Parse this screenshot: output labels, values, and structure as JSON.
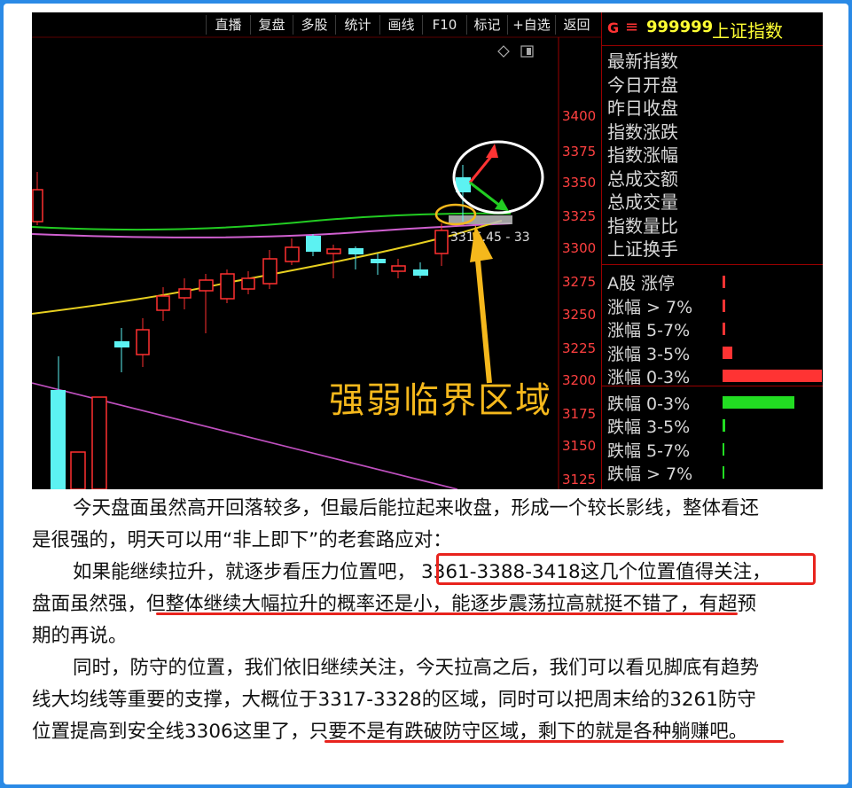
{
  "toolbar": {
    "buttons": [
      "直播",
      "复盘",
      "多股",
      "统计",
      "画线",
      "F10",
      "标记",
      "+自选",
      "返回"
    ]
  },
  "chart": {
    "price_label": "3316.45 - 33",
    "annotation": "强弱临界区域",
    "y_ticks": [
      "3400",
      "3375",
      "3350",
      "3325",
      "3300",
      "3275",
      "3250",
      "3225",
      "3200",
      "3175",
      "3150",
      "3125"
    ]
  },
  "right_panel": {
    "g_label": "G",
    "menu_icon": "≡",
    "code": "999999",
    "name": "上证指数",
    "indicators": [
      "最新指数",
      "今日开盘",
      "昨日收盘",
      "指数涨跌",
      "指数涨幅",
      "总成交额",
      "总成交量",
      "指数量比",
      "上证换手"
    ],
    "breakdown": [
      {
        "label": "A股 涨停",
        "bar_color": "#ff3333",
        "bar_fraction": 0.03
      },
      {
        "label": "涨幅 > 7%",
        "bar_color": "#ff3333",
        "bar_fraction": 0.03
      },
      {
        "label": "涨幅 5-7%",
        "bar_color": "#ff3333",
        "bar_fraction": 0.03
      },
      {
        "label": "涨幅 3-5%",
        "bar_color": "#ff3333",
        "bar_fraction": 0.1
      },
      {
        "label": "涨幅 0-3%",
        "bar_color": "#ff3333",
        "bar_fraction": 1.0
      },
      {
        "label": "跌幅 0-3%",
        "bar_color": "#22dd22",
        "bar_fraction": 0.72
      },
      {
        "label": "跌幅 3-5%",
        "bar_color": "#22dd22",
        "bar_fraction": 0.03
      },
      {
        "label": "跌幅 5-7%",
        "bar_color": "#22dd22",
        "bar_fraction": 0.01
      },
      {
        "label": "跌幅 > 7%",
        "bar_color": "#22dd22",
        "bar_fraction": 0.01
      }
    ]
  },
  "article": {
    "p1_a": "今天盘面虽然高开回落较多，但最后能拉起来收盘，形成一个较长影线，整体看还",
    "p1_b": "是很强的，明天可以用“非上即下”的老套路应对：",
    "p2_a": "如果能继续拉升，就逐步看压力位置吧，",
    "p2_box": "3361-3388-3418这几个位置值得关注，",
    "p2_b_pre": "盘面虽然强，",
    "p2_b_ul": "但整体继续大幅拉升的概率还是小，能逐步震荡拉高就挺不错了",
    "p2_b_post": "，有超预",
    "p2_c": "期的再说。",
    "p3_a": "同时，防守的位置，我们依旧继续关注，今天拉高之后，我们可以看见脚底有趋势",
    "p3_b": "线大均线等重要的支撑，大概位于3317-3328的区域，同时可以把周末给的3261防守",
    "p3_c_pre": "位置提高到安全线3306这里了，",
    "p3_c_ul": "只要不是有跌破防守区域，剩下的就是各种躺赚吧",
    "p3_c_post": "。"
  }
}
